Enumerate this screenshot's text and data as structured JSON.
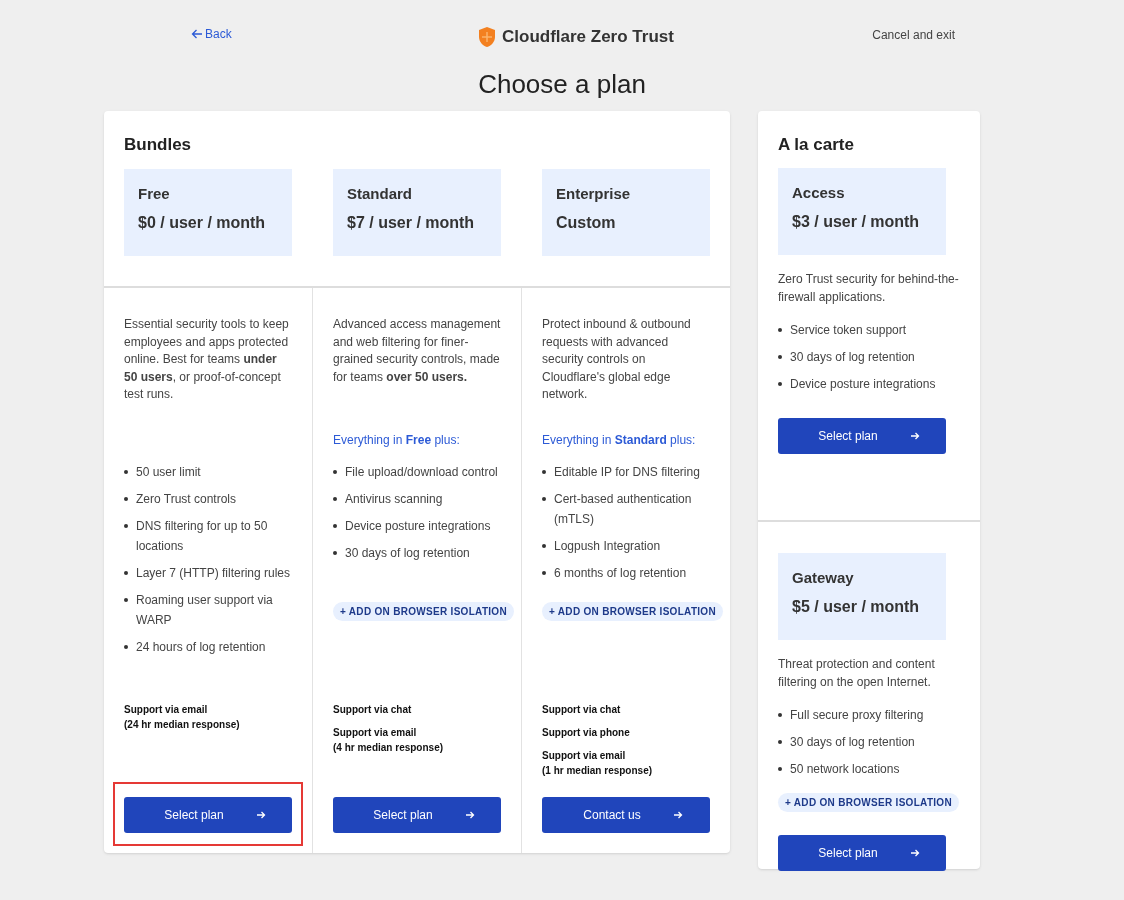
{
  "header": {
    "back": "Back",
    "brand": "Cloudflare Zero Trust",
    "cancel": "Cancel and exit"
  },
  "title": "Choose a plan",
  "bundles": {
    "title": "Bundles",
    "plans": [
      {
        "name": "Free",
        "price": "$0 / user / month",
        "description": "Essential security tools to keep employees and apps protected online. Best for teams **under 50 users**, or proof-of-concept test runs.",
        "features": [
          "50 user limit",
          "Zero Trust controls",
          "DNS filtering for up to 50 locations",
          "Layer 7 (HTTP) filtering rules",
          "Roaming user support via WARP",
          "24 hours of log retention"
        ],
        "support": [
          "Support via email\n(24 hr median response)"
        ],
        "button": "Select plan",
        "highlighted": true
      },
      {
        "name": "Standard",
        "price": "$7 / user / month",
        "description": "Advanced access management and web filtering for finer-grained security controls, made for teams **over 50 users.**",
        "includes": "Everything in **Free** plus:",
        "features": [
          "File upload/download control",
          "Antivirus scanning",
          "Device posture integrations",
          "30 days of log retention"
        ],
        "addon": "+ ADD ON BROWSER ISOLATION",
        "support": [
          "Support via chat",
          "Support via email\n(4 hr median response)"
        ],
        "button": "Select plan",
        "highlighted": false
      },
      {
        "name": "Enterprise",
        "price": "Custom",
        "description": "Protect inbound & outbound requests with advanced security controls on Cloudflare's global edge network.",
        "includes": "Everything in **Standard** plus:",
        "features": [
          "Editable IP for DNS filtering",
          "Cert-based authentication (mTLS)",
          "Logpush Integration",
          "6 months of log retention"
        ],
        "addon": "+ ADD ON BROWSER ISOLATION",
        "support": [
          "Support via chat",
          "Support via phone",
          "Support via email\n(1 hr median response)"
        ],
        "button": "Contact us",
        "highlighted": false
      }
    ]
  },
  "a_la_carte": {
    "title": "A la carte",
    "plans": [
      {
        "name": "Access",
        "price": "$3 / user / month",
        "description": "Zero Trust security for behind-the-firewall applications.",
        "features": [
          "Service token support",
          "30 days of log retention",
          "Device posture integrations"
        ],
        "button": "Select plan"
      },
      {
        "name": "Gateway",
        "price": "$5 / user / month",
        "description": "Threat protection and content filtering on the open Internet.",
        "features": [
          "Full secure proxy filtering",
          "30 days of log retention",
          "50 network locations"
        ],
        "addon": "+ ADD ON BROWSER ISOLATION",
        "button": "Select plan"
      }
    ]
  }
}
